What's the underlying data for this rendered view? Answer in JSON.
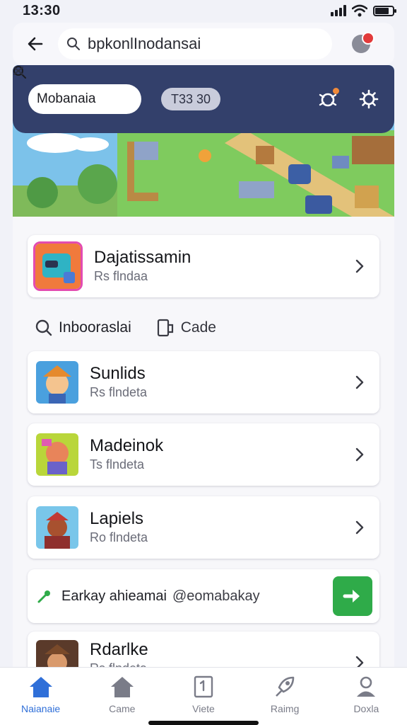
{
  "status_bar": {
    "time": "13:30"
  },
  "search": {
    "query": "bpkonlInodansai"
  },
  "banner": {
    "search_value": "Mobanaia",
    "chip_label": "T33 30"
  },
  "featured": {
    "title": "Dajatissamin",
    "subtitle": "Rs flndaa"
  },
  "section": {
    "label": "Inbooraslai",
    "link_label": "Cade"
  },
  "apps": [
    {
      "title": "Sunlids",
      "subtitle": "Rs flndeta"
    },
    {
      "title": "Madeinok",
      "subtitle": "Ts flndeta"
    },
    {
      "title": "Lapiels",
      "subtitle": "Ro flndeta"
    }
  ],
  "promo": {
    "text": "Earkay ahieamai",
    "handle": "@eomabakay"
  },
  "partial_card": {
    "title": "Rdarlke",
    "subtitle": "Rs flndeta"
  },
  "bottom_nav": [
    {
      "label": "Naianaie",
      "icon": "home-icon",
      "active": true
    },
    {
      "label": "Came",
      "icon": "house-icon",
      "active": false
    },
    {
      "label": "Viete",
      "icon": "clipboard-icon",
      "active": false
    },
    {
      "label": "Raimg",
      "icon": "rocket-icon",
      "active": false
    },
    {
      "label": "Doxla",
      "icon": "person-icon",
      "active": false
    }
  ],
  "colors": {
    "banner_header": "#33406b",
    "accent_blue": "#2f6fd8",
    "promo_green": "#2fab49",
    "notification_red": "#e23b3b"
  }
}
